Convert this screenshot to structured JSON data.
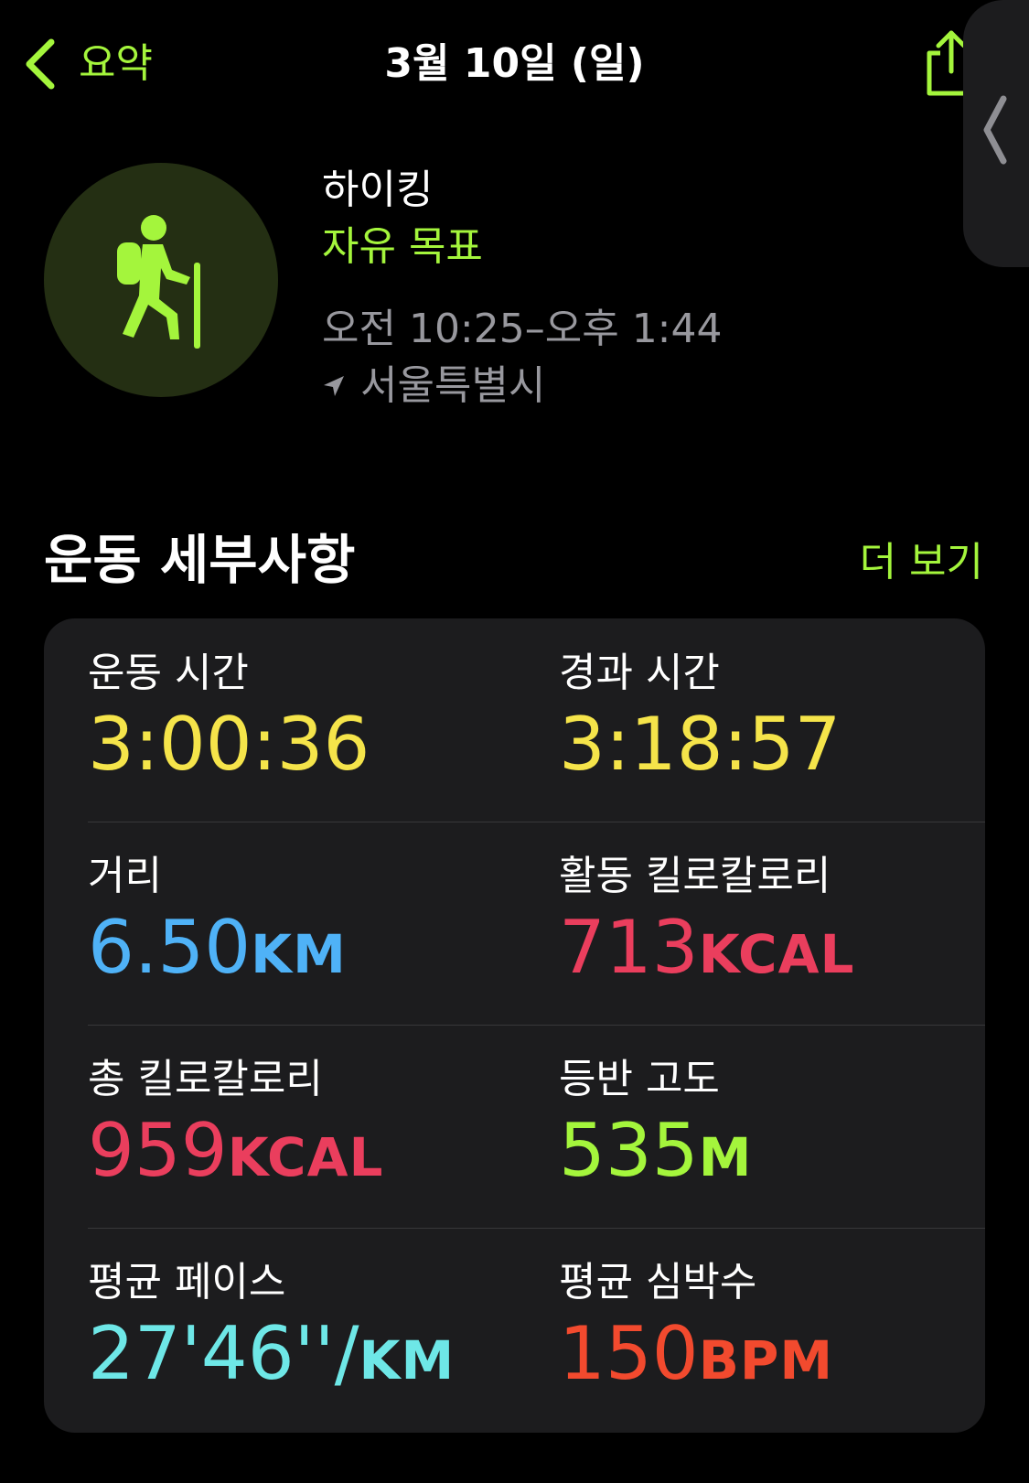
{
  "nav": {
    "back_label": "요약",
    "title": "3월 10일 (일)"
  },
  "workout": {
    "name": "하이킹",
    "goal": "자유 목표",
    "time_range": "오전 10:25–오후 1:44",
    "location": "서울특별시",
    "icon": "hiker-icon"
  },
  "section": {
    "title": "운동 세부사항",
    "more_label": "더 보기"
  },
  "colors": {
    "accent": "#a4f53c",
    "yellow": "#f5e44a",
    "blue": "#4fb2f7",
    "red": "#ea3e5d",
    "green": "#a4f53c",
    "cyan": "#6ee7e7",
    "orange": "#f24a2e"
  },
  "metrics": [
    {
      "label": "운동 시간",
      "value": "3:00:36",
      "unit": ""
    },
    {
      "label": "경과 시간",
      "value": "3:18:57",
      "unit": ""
    },
    {
      "label": "거리",
      "value": "6.50",
      "unit": "KM"
    },
    {
      "label": "활동 킬로칼로리",
      "value": "713",
      "unit": "KCAL"
    },
    {
      "label": "총 킬로칼로리",
      "value": "959",
      "unit": "KCAL"
    },
    {
      "label": "등반 고도",
      "value": "535",
      "unit": "M"
    },
    {
      "label": "평균 페이스",
      "value": "27'46''/",
      "unit": "KM"
    },
    {
      "label": "평균 심박수",
      "value": "150",
      "unit": "BPM"
    }
  ]
}
